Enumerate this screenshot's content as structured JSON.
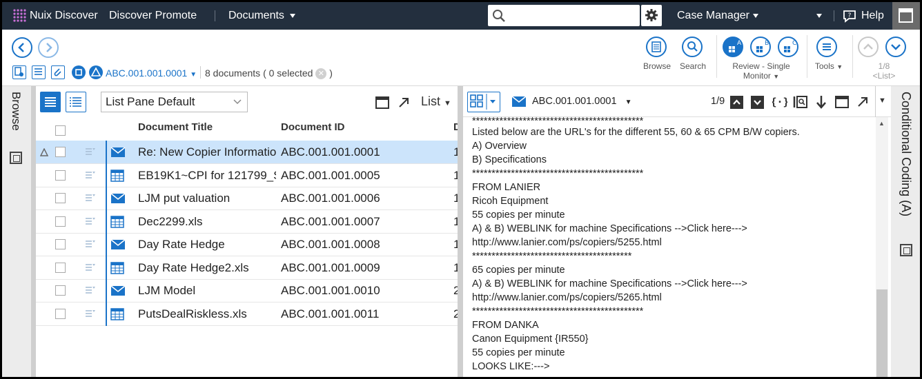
{
  "topbar": {
    "app_name": "Nuix Discover",
    "case_name": "Discover Promote",
    "module": "Documents",
    "search_placeholder": "",
    "case_manager": "Case Manager",
    "help": "Help"
  },
  "toolbar": {
    "current_doc": "ABC.001.001.0001",
    "doc_count": "8 documents",
    "selected_open": "(",
    "selected_text": "0 selected",
    "selected_close": ")",
    "browse": "Browse",
    "search": "Search",
    "review_line1": "Review - Single",
    "review_line2": "Monitor",
    "tools": "Tools",
    "nav_line1": "1/8",
    "nav_line2": "<List>",
    "review_badges": [
      "A",
      "B",
      "C"
    ]
  },
  "left_rail": {
    "label": "Browse"
  },
  "right_rail": {
    "label": "Conditional Coding (A)"
  },
  "list_pane": {
    "view_name": "List Pane Default",
    "list_label": "List",
    "columns": [
      "Document Title",
      "Document ID",
      "D"
    ],
    "rows": [
      {
        "title": "Re: New Copier Information",
        "id": "ABC.001.001.0001",
        "d": "1",
        "type": "email",
        "selected": true
      },
      {
        "title": "EB19K1~CPI for 121799_SP",
        "id": "ABC.001.001.0005",
        "d": "1",
        "type": "sheet",
        "selected": false
      },
      {
        "title": "LJM put valuation",
        "id": "ABC.001.001.0006",
        "d": "1",
        "type": "email",
        "selected": false
      },
      {
        "title": "Dec2299.xls",
        "id": "ABC.001.001.0007",
        "d": "1",
        "type": "sheet",
        "selected": false
      },
      {
        "title": "Day Rate Hedge",
        "id": "ABC.001.001.0008",
        "d": "1",
        "type": "email",
        "selected": false
      },
      {
        "title": "Day Rate Hedge2.xls",
        "id": "ABC.001.001.0009",
        "d": "1",
        "type": "sheet",
        "selected": false
      },
      {
        "title": "LJM Model",
        "id": "ABC.001.001.0010",
        "d": "2",
        "type": "email",
        "selected": false
      },
      {
        "title": "PutsDealRiskless.xls",
        "id": "ABC.001.001.0011",
        "d": "2",
        "type": "sheet",
        "selected": false
      }
    ]
  },
  "doc_pane": {
    "doc_id": "ABC.001.001.0001",
    "position": "1/9",
    "lines": [
      "********************************************",
      "Listed below are the URL's for the different 55, 60 & 65 CPM B/W copiers.",
      "A) Overview",
      "B) Specifications",
      "********************************************",
      "FROM LANIER",
      "Ricoh Equipment",
      "55 copies per minute",
      "A) & B) WEBLINK for machine Specifications -->Click here--->",
      "http://www.lanier.com/ps/copiers/5255.html",
      "*****************************************",
      "65 copies per minute",
      "A) & B) WEBLINK for machine Specifications -->Click here--->",
      "http://www.lanier.com/ps/copiers/5265.html",
      "********************************************",
      "FROM DANKA",
      "Canon Equipment {IR550}",
      "55 copies per minute",
      "LOOKS LIKE:--->"
    ]
  },
  "colors": {
    "accent": "#1a73c8",
    "topbar": "#232f3e",
    "selected_row": "#cce4fb"
  }
}
